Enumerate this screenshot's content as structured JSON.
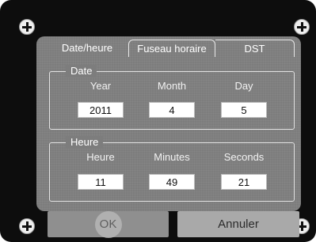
{
  "tabs": [
    {
      "label": "Date/heure"
    },
    {
      "label": "Fuseau horaire"
    },
    {
      "label": "DST"
    }
  ],
  "date_group": {
    "legend": "Date",
    "columns": [
      {
        "label": "Year",
        "value": "2011"
      },
      {
        "label": "Month",
        "value": "4"
      },
      {
        "label": "Day",
        "value": "5"
      }
    ]
  },
  "time_group": {
    "legend": "Heure",
    "columns": [
      {
        "label": "Heure",
        "value": "11"
      },
      {
        "label": "Minutes",
        "value": "49"
      },
      {
        "label": "Seconds",
        "value": "21"
      }
    ]
  },
  "buttons": {
    "ok_label": "OK",
    "cancel_label": "Annuler"
  }
}
